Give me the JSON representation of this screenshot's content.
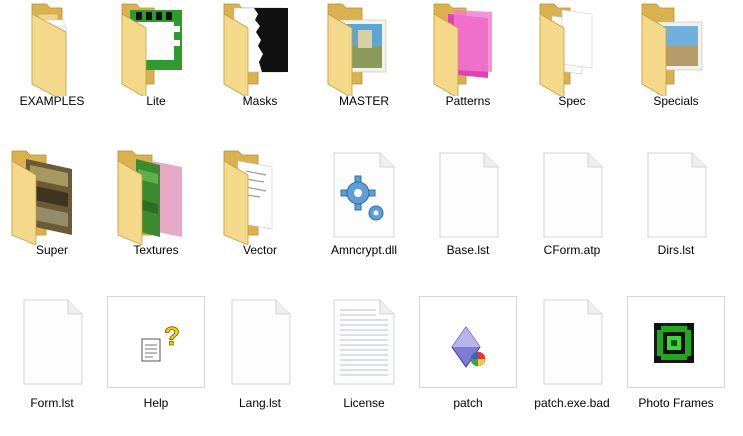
{
  "items": [
    {
      "label": "EXAMPLES",
      "icon": "folder-icon"
    },
    {
      "label": "Lite",
      "icon": "folder-icon"
    },
    {
      "label": "Masks",
      "icon": "folder-icon"
    },
    {
      "label": "MASTER",
      "icon": "folder-icon"
    },
    {
      "label": "Patterns",
      "icon": "folder-icon"
    },
    {
      "label": "Spec",
      "icon": "folder-icon"
    },
    {
      "label": "Specials",
      "icon": "folder-icon"
    },
    {
      "label": "Super",
      "icon": "folder-icon"
    },
    {
      "label": "Textures",
      "icon": "folder-icon"
    },
    {
      "label": "Vector",
      "icon": "folder-icon"
    },
    {
      "label": "Amncrypt.dll",
      "icon": "gear-file-icon"
    },
    {
      "label": "Base.lst",
      "icon": "blank-file-icon"
    },
    {
      "label": "CForm.atp",
      "icon": "blank-file-icon"
    },
    {
      "label": "Dirs.lst",
      "icon": "blank-file-icon"
    },
    {
      "label": "Form.lst",
      "icon": "blank-file-icon"
    },
    {
      "label": "Help",
      "icon": "help-file-icon"
    },
    {
      "label": "Lang.lst",
      "icon": "blank-file-icon"
    },
    {
      "label": "License",
      "icon": "text-file-icon"
    },
    {
      "label": "patch",
      "icon": "installer-icon"
    },
    {
      "label": "patch.exe.bad",
      "icon": "blank-file-icon"
    },
    {
      "label": "Photo Frames",
      "icon": "photo-frames-app-icon"
    }
  ],
  "colors": {
    "folder_back": "#e3bf5c",
    "folder_front": "#f6dd91",
    "patterns_pink": "#e040b8",
    "frames_green": "#1ea81e"
  }
}
